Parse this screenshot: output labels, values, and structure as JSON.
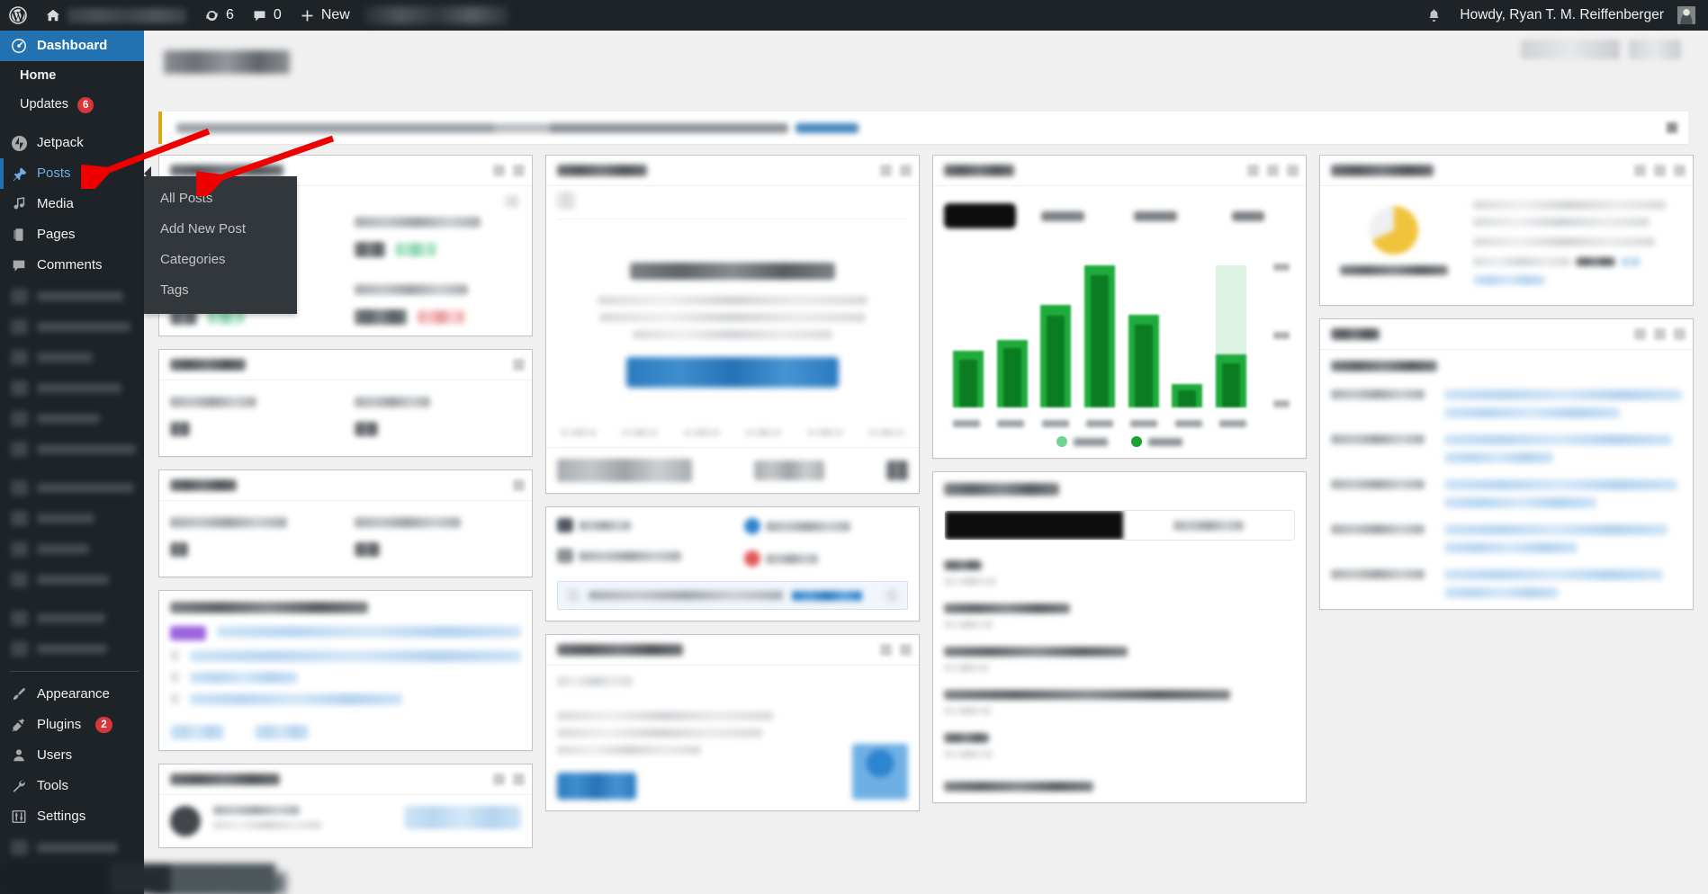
{
  "adminbar": {
    "wp_logo_icon": "wordpress-logo-icon",
    "home_icon": "home-icon",
    "site_name_redacted": "",
    "updates_icon": "updates-refresh-icon",
    "updates_count": "6",
    "comments_icon": "comment-bubble-icon",
    "comments_count": "0",
    "new_icon": "plus-icon",
    "new_label": "New",
    "notifications_icon": "bell-icon",
    "howdy": "Howdy, Ryan T. M. Reiffenberger",
    "avatar": "user-avatar"
  },
  "sidebar": {
    "items": [
      {
        "label": "Dashboard",
        "icon": "dashboard-icon",
        "state": "active"
      },
      {
        "label": "Home",
        "icon": "",
        "state": "submenu-current"
      },
      {
        "label": "Updates",
        "icon": "",
        "badge": "6",
        "state": "submenu"
      },
      {
        "label": "Jetpack",
        "icon": "jetpack-icon",
        "state": "normal"
      },
      {
        "label": "Posts",
        "icon": "pin-icon",
        "state": "hover"
      },
      {
        "label": "Media",
        "icon": "media-icon",
        "state": "normal"
      },
      {
        "label": "Pages",
        "icon": "pages-icon",
        "state": "normal"
      },
      {
        "label": "Comments",
        "icon": "comments-icon",
        "state": "normal"
      },
      {
        "label": "Appearance",
        "icon": "appearance-brush-icon",
        "state": "normal"
      },
      {
        "label": "Plugins",
        "icon": "plugins-plug-icon",
        "badge": "2",
        "state": "normal"
      },
      {
        "label": "Users",
        "icon": "users-icon",
        "state": "normal"
      },
      {
        "label": "Tools",
        "icon": "tools-wrench-icon",
        "state": "normal"
      },
      {
        "label": "Settings",
        "icon": "settings-sliders-icon",
        "state": "normal"
      }
    ],
    "blurred_item_count": 12,
    "collapse_menu_redacted": ""
  },
  "flyout": {
    "parent": "Posts",
    "items": [
      {
        "label": "All Posts"
      },
      {
        "label": "Add New Post"
      },
      {
        "label": "Categories"
      },
      {
        "label": "Tags"
      }
    ]
  },
  "page": {
    "title_redacted": "Dashboard",
    "screen_options_redacted": "",
    "notice_redacted": "",
    "notice_accent": "#dba617"
  },
  "widgets": {
    "col1": [
      {
        "title_redacted": "",
        "kind": "seo-stats"
      },
      {
        "title_redacted": "",
        "kind": "site-keywords"
      },
      {
        "title_redacted": "",
        "kind": "backlinks"
      },
      {
        "title_redacted": "",
        "kind": "latest-blog-posts"
      },
      {
        "title_redacted": "",
        "kind": "activity"
      }
    ],
    "col2": [
      {
        "title_redacted": "",
        "kind": "jetpack-stats"
      },
      {
        "title_redacted": "",
        "kind": "at-a-glance"
      },
      {
        "title_redacted": "",
        "kind": "wordpress-events"
      }
    ],
    "col3": [
      {
        "title_redacted": "",
        "kind": "search-stats-chart"
      },
      {
        "title_redacted": "",
        "kind": "highlights"
      }
    ],
    "col4": [
      {
        "title_redacted": "",
        "kind": "site-health-status"
      },
      {
        "title_redacted": "",
        "kind": "activity-feed"
      }
    ]
  },
  "chart_data": {
    "type": "bar",
    "title_redacted": "",
    "tabs_redacted": [
      "",
      "",
      "",
      ""
    ],
    "selected_tab_index": 0,
    "categories": [
      "",
      "",
      "",
      "",
      "",
      "",
      ""
    ],
    "series": [
      {
        "name": "",
        "color": "#d9f2e0",
        "values": [
          0,
          0,
          0,
          0,
          0,
          0,
          86
        ]
      },
      {
        "name": "",
        "color": "#1fab3c",
        "values": [
          34,
          41,
          62,
          86,
          56,
          14,
          32
        ]
      },
      {
        "name": "",
        "color": "#0b7c21",
        "values": [
          29,
          36,
          55,
          80,
          50,
          10,
          27
        ]
      }
    ],
    "ylim": [
      0,
      100
    ],
    "ytick_count": 3,
    "legend_position": "bottom",
    "grid": false,
    "redacted": true
  },
  "annotations": [
    {
      "name": "arrow-to-posts",
      "color": "#ee0000",
      "from": [
        210,
        150
      ],
      "to": [
        108,
        182
      ]
    },
    {
      "name": "arrow-to-add-new-post",
      "color": "#ee0000",
      "from": [
        350,
        153
      ],
      "to": [
        232,
        197
      ]
    }
  ],
  "colors": {
    "admin_bg": "#1d2327",
    "admin_accent": "#2271b1",
    "submenu_bg": "#32373c",
    "badge_red": "#d63638",
    "chart_green": "#1fab3c",
    "chart_green_dark": "#0b7c21",
    "chart_green_light": "#d9f2e0",
    "notice_yellow": "#dba617",
    "annotation_red": "#ee0000"
  },
  "dock": {
    "redacted": true
  }
}
